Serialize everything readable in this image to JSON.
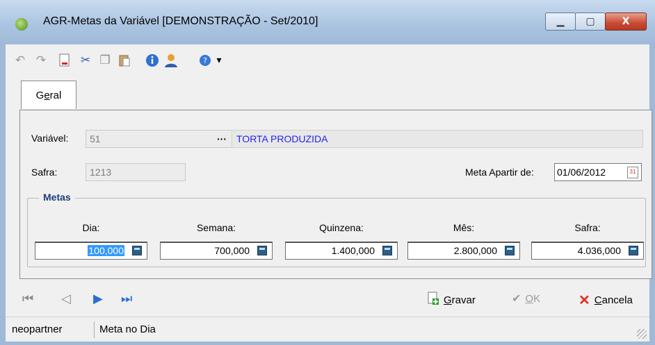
{
  "window": {
    "title": "AGR-Metas da Variável [DEMONSTRAÇÃO - Set/2010]",
    "buttons": {
      "minimize": "▁",
      "maximize": "▢",
      "close": "X"
    }
  },
  "toolbar": {
    "icons": [
      "undo-icon",
      "redo-icon",
      "new-document-icon",
      "cut-icon",
      "copy-icon",
      "paste-icon",
      "info-icon",
      "user-icon",
      "help-icon"
    ],
    "dropdown_arrow": "▾"
  },
  "tabs": [
    {
      "label_prefix": "G",
      "label_accel": "e",
      "label_suffix": "ral"
    }
  ],
  "form": {
    "variavel_label": "Variável:",
    "variavel_code": "51",
    "lookup_button": "···",
    "variavel_desc": "TORTA PRODUZIDA",
    "safra_label": "Safra:",
    "safra_value": "1213",
    "meta_apartir_label": "Meta Apartir de:",
    "meta_apartir_value": "01/06/2012",
    "calendar_glyph": "31"
  },
  "metas": {
    "title": "Metas",
    "columns": [
      {
        "label": "Dia:",
        "value": "100,000"
      },
      {
        "label": "Semana:",
        "value": "700,000"
      },
      {
        "label": "Quinzena:",
        "value": "1.400,000"
      },
      {
        "label": "Mês:",
        "value": "2.800,000"
      },
      {
        "label": "Safra:",
        "value": "4.036,000"
      }
    ]
  },
  "nav": {
    "first": "⏮",
    "prev": "◁",
    "next": "▶",
    "last": "⏭"
  },
  "actions": {
    "gravar_accel": "G",
    "gravar_rest": "ravar",
    "ok_accel": "O",
    "ok_rest": "K",
    "cancela_accel": "C",
    "cancela_rest": "ancela"
  },
  "status": {
    "user": "neopartner",
    "message": "Meta no Dia"
  }
}
